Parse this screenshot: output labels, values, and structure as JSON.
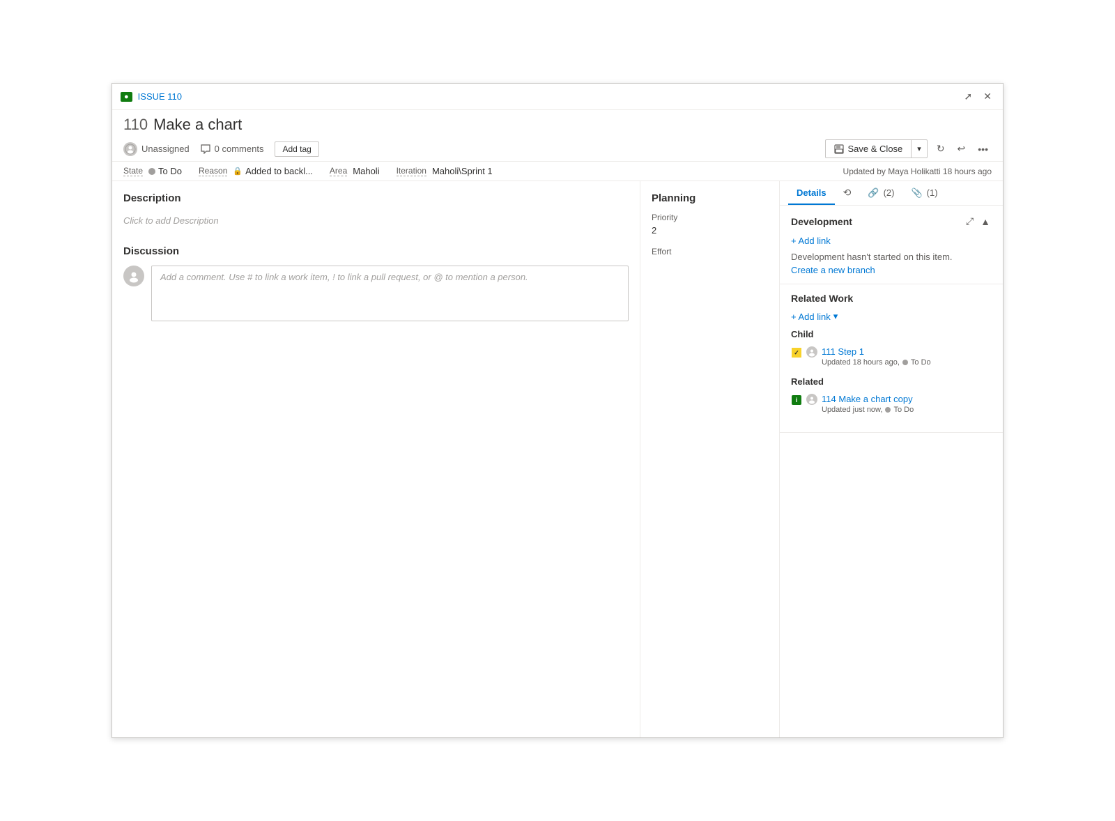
{
  "window": {
    "issue_badge": "●",
    "issue_link_text": "ISSUE 110",
    "issue_number": "110",
    "issue_title": "Make a chart",
    "close_icon": "✕",
    "expand_icon": "⤢",
    "collapse_icon": "⤡"
  },
  "toolbar": {
    "unassigned_label": "Unassigned",
    "comments_count": "0 comments",
    "add_tag_label": "Add tag",
    "save_close_label": "Save & Close",
    "refresh_icon": "↻",
    "undo_icon": "↩",
    "more_icon": "···"
  },
  "metadata": {
    "state_label": "State",
    "state_value": "To Do",
    "reason_label": "Reason",
    "reason_value": "Added to backl...",
    "area_label": "Area",
    "area_value": "Maholi",
    "iteration_label": "Iteration",
    "iteration_value": "Maholi\\Sprint 1",
    "updated_text": "Updated by Maya Holikatti 18 hours ago"
  },
  "tabs": {
    "details_label": "Details",
    "history_icon": "⟲",
    "links_label": "(2)",
    "attachments_label": "(1)"
  },
  "description": {
    "section_title": "Description",
    "placeholder": "Click to add Description"
  },
  "discussion": {
    "section_title": "Discussion",
    "comment_placeholder": "Add a comment. Use # to link a work item, ! to link a pull request, or @ to mention a person."
  },
  "planning": {
    "section_title": "Planning",
    "priority_label": "Priority",
    "priority_value": "2",
    "effort_label": "Effort",
    "effort_value": ""
  },
  "development": {
    "section_title": "Development",
    "add_link_label": "+ Add link",
    "no_start_text": "Development hasn't started on this item.",
    "create_branch_label": "Create a new branch"
  },
  "related_work": {
    "section_title": "Related Work",
    "add_link_label": "+ Add link",
    "child_label": "Child",
    "child_item_number": "111",
    "child_item_title": "Step 1",
    "child_item_meta": "Updated 18 hours ago,",
    "child_item_status": "To Do",
    "related_label": "Related",
    "related_item_number": "114",
    "related_item_title": "Make a chart copy",
    "related_item_meta": "Updated just now,",
    "related_item_status": "To Do"
  }
}
